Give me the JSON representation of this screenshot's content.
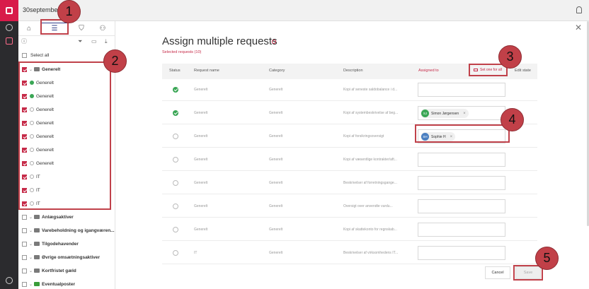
{
  "window": {
    "title": "30september"
  },
  "sidebar": {
    "select_all": "Select all",
    "items": [
      {
        "label": "Generelt",
        "kind": "folder",
        "checked": true,
        "expanded": true
      },
      {
        "label": "Generelt",
        "kind": "request",
        "checked": true,
        "status": "done"
      },
      {
        "label": "Generelt",
        "kind": "request",
        "checked": true,
        "status": "done"
      },
      {
        "label": "Generelt",
        "kind": "request",
        "checked": true,
        "status": "open"
      },
      {
        "label": "Generelt",
        "kind": "request",
        "checked": true,
        "status": "open"
      },
      {
        "label": "Generelt",
        "kind": "request",
        "checked": true,
        "status": "open"
      },
      {
        "label": "Generelt",
        "kind": "request",
        "checked": true,
        "status": "open"
      },
      {
        "label": "Generelt",
        "kind": "request",
        "checked": true,
        "status": "open"
      },
      {
        "label": "IT",
        "kind": "request",
        "checked": true,
        "status": "open"
      },
      {
        "label": "IT",
        "kind": "request",
        "checked": true,
        "status": "open"
      },
      {
        "label": "IT",
        "kind": "request",
        "checked": true,
        "status": "open"
      },
      {
        "label": "Anlægsaktiver",
        "kind": "folder",
        "checked": false
      },
      {
        "label": "Varebeholdning og igangværen...",
        "kind": "folder",
        "checked": false
      },
      {
        "label": "Tilgodehavender",
        "kind": "folder",
        "checked": false
      },
      {
        "label": "Øvrige omsætningsaktiver",
        "kind": "folder",
        "checked": false
      },
      {
        "label": "Kortfristet gæld",
        "kind": "folder",
        "checked": false
      },
      {
        "label": "Eventualposter",
        "kind": "folder",
        "checked": false,
        "green": true
      }
    ]
  },
  "dialog": {
    "title": "Assign multiple requests",
    "selected": "Selected requests (10)",
    "columns": {
      "status": "Status",
      "request_name": "Request name",
      "category": "Category",
      "description": "Description",
      "assigned_to": "Assigned to",
      "set_one_for_all": "Set one for all",
      "edit_state": "Edit state"
    },
    "rows": [
      {
        "status": "done",
        "name": "Generelt",
        "category": "Generelt",
        "description": "Kopi af seneste saldobalance i d...",
        "assignee": ""
      },
      {
        "status": "done",
        "name": "Generelt",
        "category": "Generelt",
        "description": "Kopi af systembeskrivelse af beg...",
        "assignee": "Simon Jørgensen",
        "initials": "SJ",
        "avatar_color": "#3aa655"
      },
      {
        "status": "open",
        "name": "Generelt",
        "category": "Generelt",
        "description": "Kopi af forsikringsoversigt",
        "assignee": "Sophie H",
        "initials": "SH",
        "avatar_color": "#4a7fc1"
      },
      {
        "status": "open",
        "name": "Generelt",
        "category": "Generelt",
        "description": "Kopi af væsentlige kontrakter/aft...",
        "assignee": ""
      },
      {
        "status": "open",
        "name": "Generelt",
        "category": "Generelt",
        "description": "Beskrivelser af forretningsgange...",
        "assignee": ""
      },
      {
        "status": "open",
        "name": "Generelt",
        "category": "Generelt",
        "description": "Oversigt over anvendte vurdu...",
        "assignee": ""
      },
      {
        "status": "open",
        "name": "Generelt",
        "category": "Generelt",
        "description": "Kopi af skattekonto for regnskab...",
        "assignee": ""
      },
      {
        "status": "open",
        "name": "IT",
        "category": "Generelt",
        "description": "Beskrivelser af virksomhedens IT...",
        "assignee": ""
      }
    ],
    "cancel": "Cancel",
    "save": "Save"
  },
  "annotations": [
    "1",
    "2",
    "3",
    "4",
    "5"
  ],
  "colors": {
    "accent": "#c62a48",
    "brand": "#d81b4a",
    "annotation": "#c14048"
  }
}
